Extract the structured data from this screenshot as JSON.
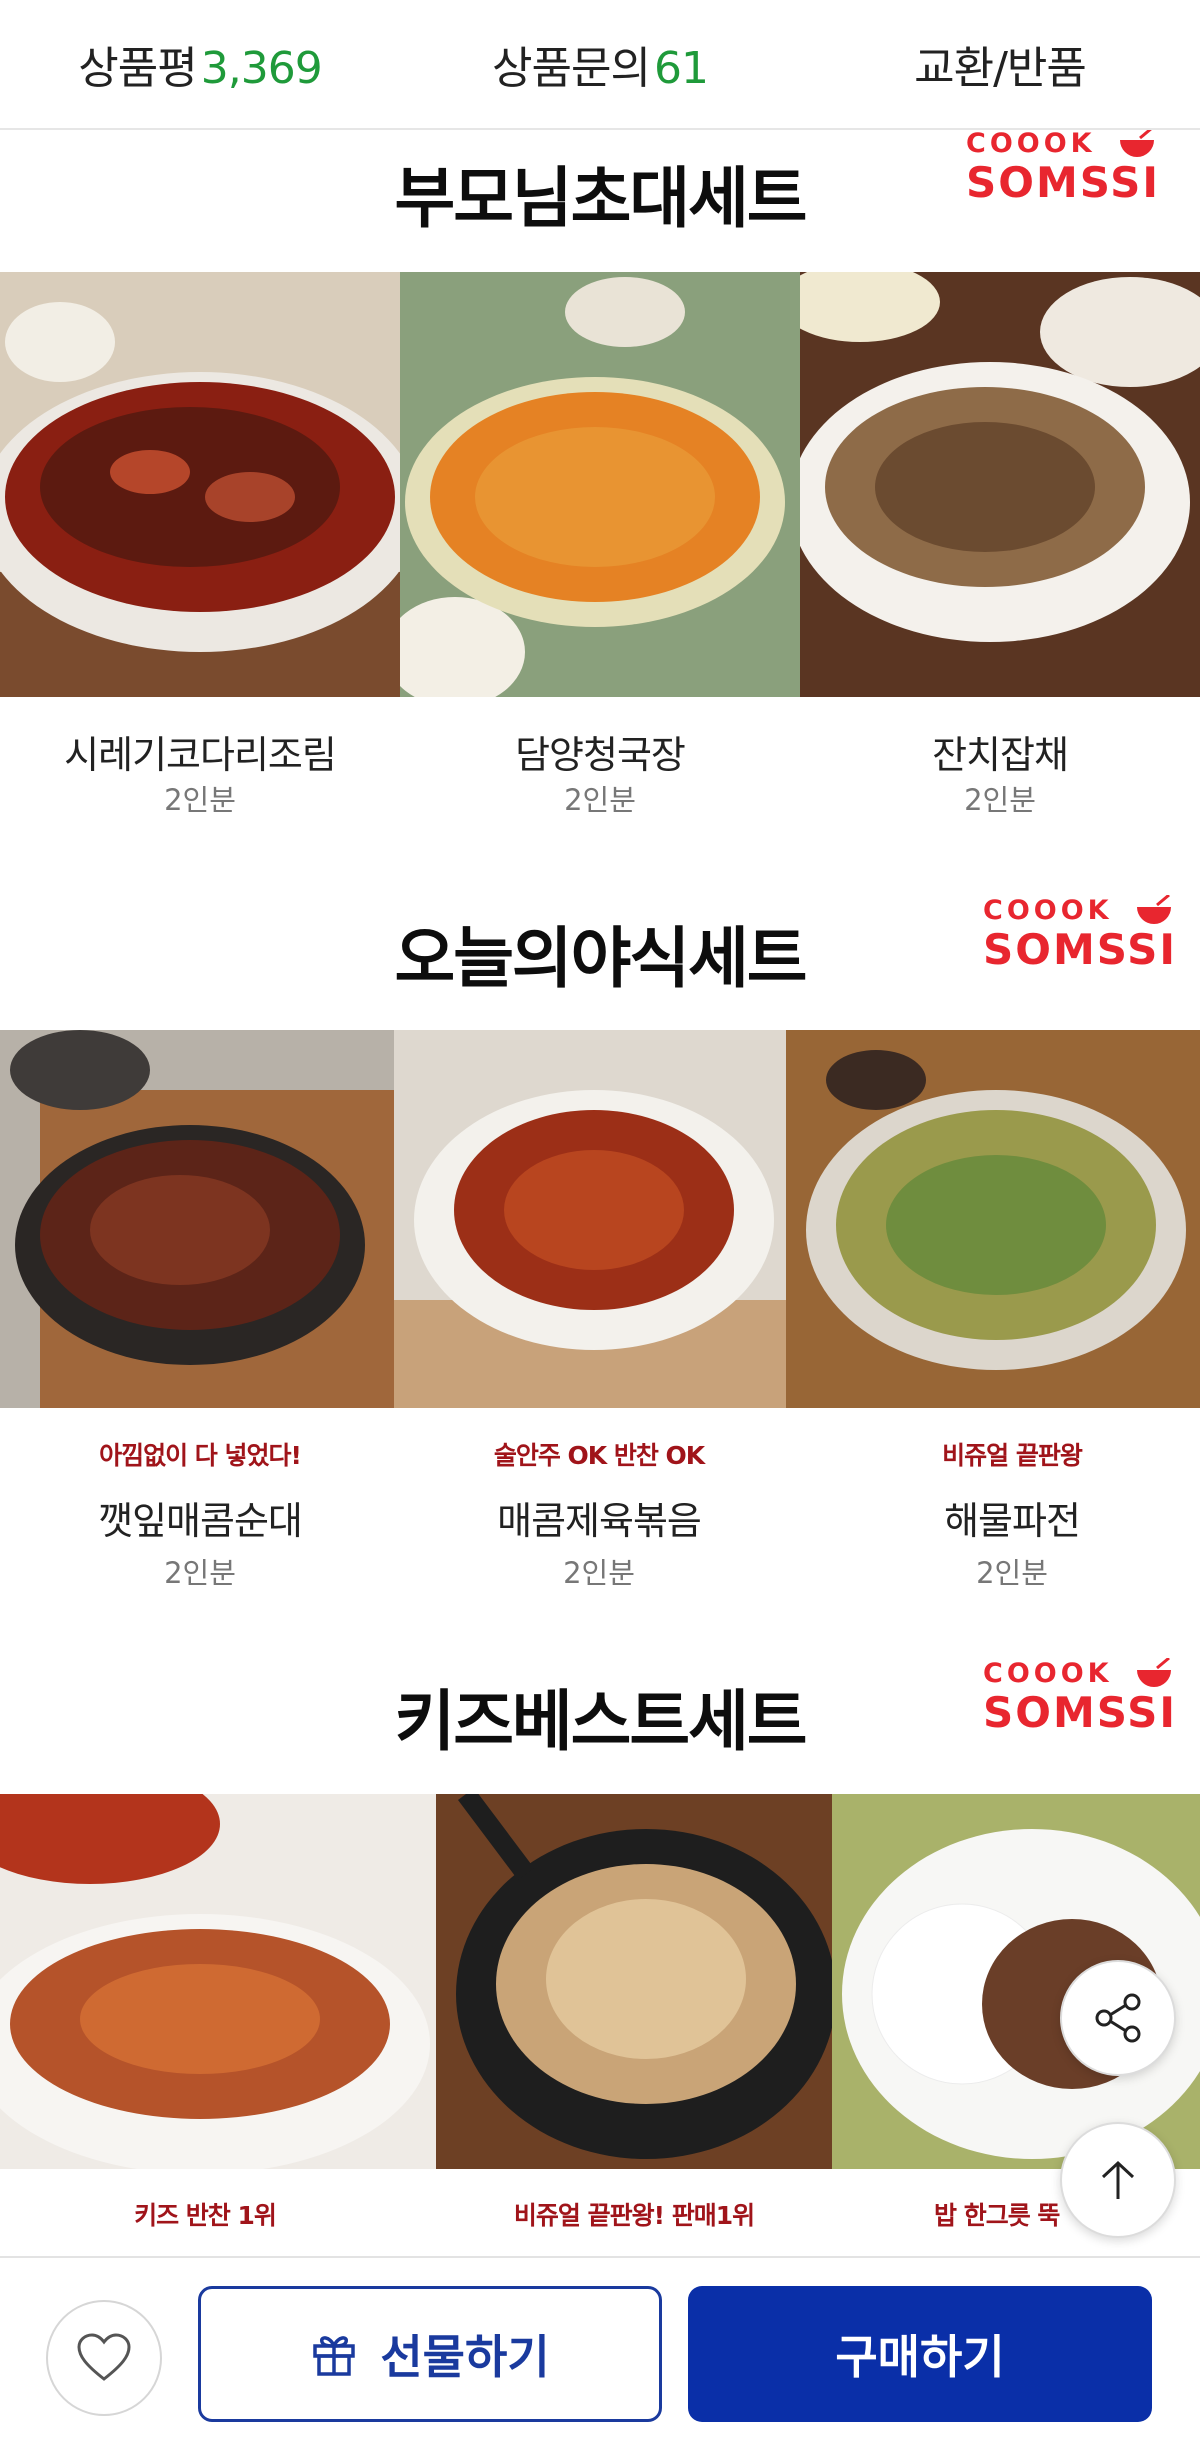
{
  "tabs": [
    {
      "label": "상품평",
      "count": "3,369"
    },
    {
      "label": "상품문의",
      "count": "61"
    },
    {
      "label": "교환/반품",
      "count": ""
    }
  ],
  "brand": {
    "top": "COOOK",
    "bottom": "SOMSSI"
  },
  "sections": [
    {
      "title": "부모님초대세트",
      "items": [
        {
          "name": "시레기코다리조림",
          "serving": "2인분",
          "tag": ""
        },
        {
          "name": "담양청국장",
          "serving": "2인분",
          "tag": ""
        },
        {
          "name": "잔치잡채",
          "serving": "2인분",
          "tag": ""
        }
      ]
    },
    {
      "title": "오늘의야식세트",
      "items": [
        {
          "name": "깻잎매콤순대",
          "serving": "2인분",
          "tag": "아낌없이 다 넣었다!"
        },
        {
          "name": "매콤제육볶음",
          "serving": "2인분",
          "tag": "술안주 OK 반찬 OK"
        },
        {
          "name": "해물파전",
          "serving": "2인분",
          "tag": "비쥬얼 끝판왕"
        }
      ]
    },
    {
      "title": "키즈베스트세트",
      "items": [
        {
          "name": "",
          "serving": "",
          "tag": "키즈 반찬 1위"
        },
        {
          "name": "",
          "serving": "",
          "tag": "비쥬얼 끝판왕! 판매1위"
        },
        {
          "name": "",
          "serving": "",
          "tag": "밥 한그릇 뚝"
        }
      ]
    }
  ],
  "actions": {
    "gift_label": "선물하기",
    "buy_label": "구매하기"
  },
  "icons": {
    "share": "share-icon",
    "top": "arrow-up-icon",
    "wish": "heart-icon",
    "gift": "gift-icon"
  },
  "colors": {
    "brand_red": "#e8262f",
    "primary_blue": "#0a2fa8",
    "count_green": "#1f9a3a",
    "tag_red": "#a0141a"
  }
}
